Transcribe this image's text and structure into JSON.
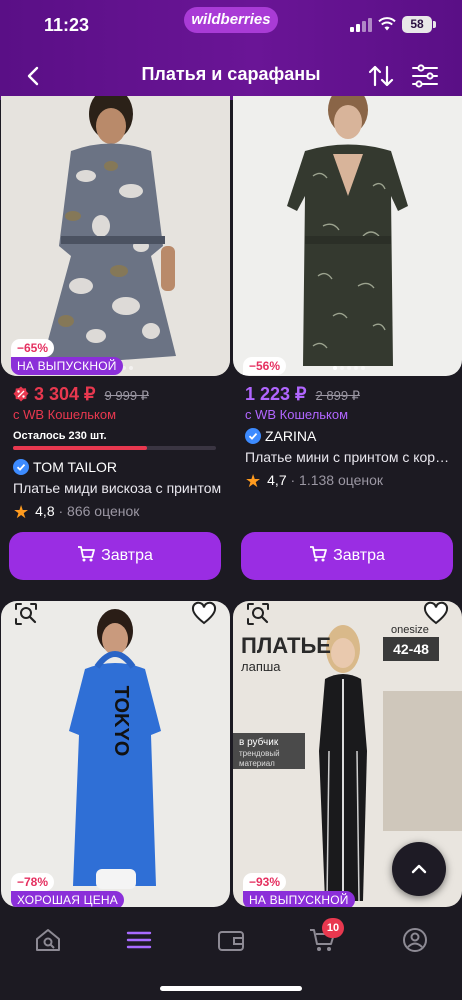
{
  "status_bar": {
    "time": "11:23",
    "battery": "58"
  },
  "header": {
    "logo": "wildberries",
    "title": "Платья и сарафаны"
  },
  "products": [
    {
      "discount": "−65%",
      "promo": "НА ВЫПУСКНОЙ",
      "price": "3 304 ₽",
      "old_price": "9 999 ₽",
      "wallet_note": "с WB Кошельком",
      "stock_text": "Осталось 230 шт.",
      "stock_level": 0.66,
      "brand": "TOM TAILOR",
      "name": "Платье миди вискоза с принтом",
      "rating": "4,8",
      "reviews": "· 866 оценок",
      "button": "Завтра"
    },
    {
      "discount": "−56%",
      "price": "1 223 ₽",
      "old_price": "2 899 ₽",
      "wallet_note": "с WB Кошельком",
      "brand": "ZARINA",
      "name": "Платье мини с принтом с короткими рукавами",
      "rating": "4,7",
      "reviews": "· 1.138 оценок",
      "button": "Завтра"
    },
    {
      "discount": "−78%",
      "promo": "ХОРОШАЯ ЦЕНА",
      "print_text": "TOKYO"
    },
    {
      "discount": "−93%",
      "promo": "НА ВЫПУСКНОЙ",
      "headline": "ПЛАТЬЕ",
      "subline": "лапша",
      "brand_mark": "onesize",
      "sizes": "42-48",
      "tag_line1": "в рубчик",
      "tag_line2": "трендовый",
      "tag_line3": "материал"
    }
  ],
  "bottom_nav": {
    "cart_count": "10"
  },
  "colors": {
    "header": "#6a1596",
    "accent": "#9a2de3",
    "price_red": "#e8384f",
    "price_violet": "#b166ff",
    "background": "#1c1a22"
  },
  "icons": [
    "back-icon",
    "sort-icon",
    "filter-icon",
    "search-by-photo-icon",
    "heart-icon",
    "verified-icon",
    "star-icon",
    "cart-icon",
    "home-icon",
    "catalog-icon",
    "wallet-icon",
    "profile-icon",
    "arrow-up-icon"
  ]
}
